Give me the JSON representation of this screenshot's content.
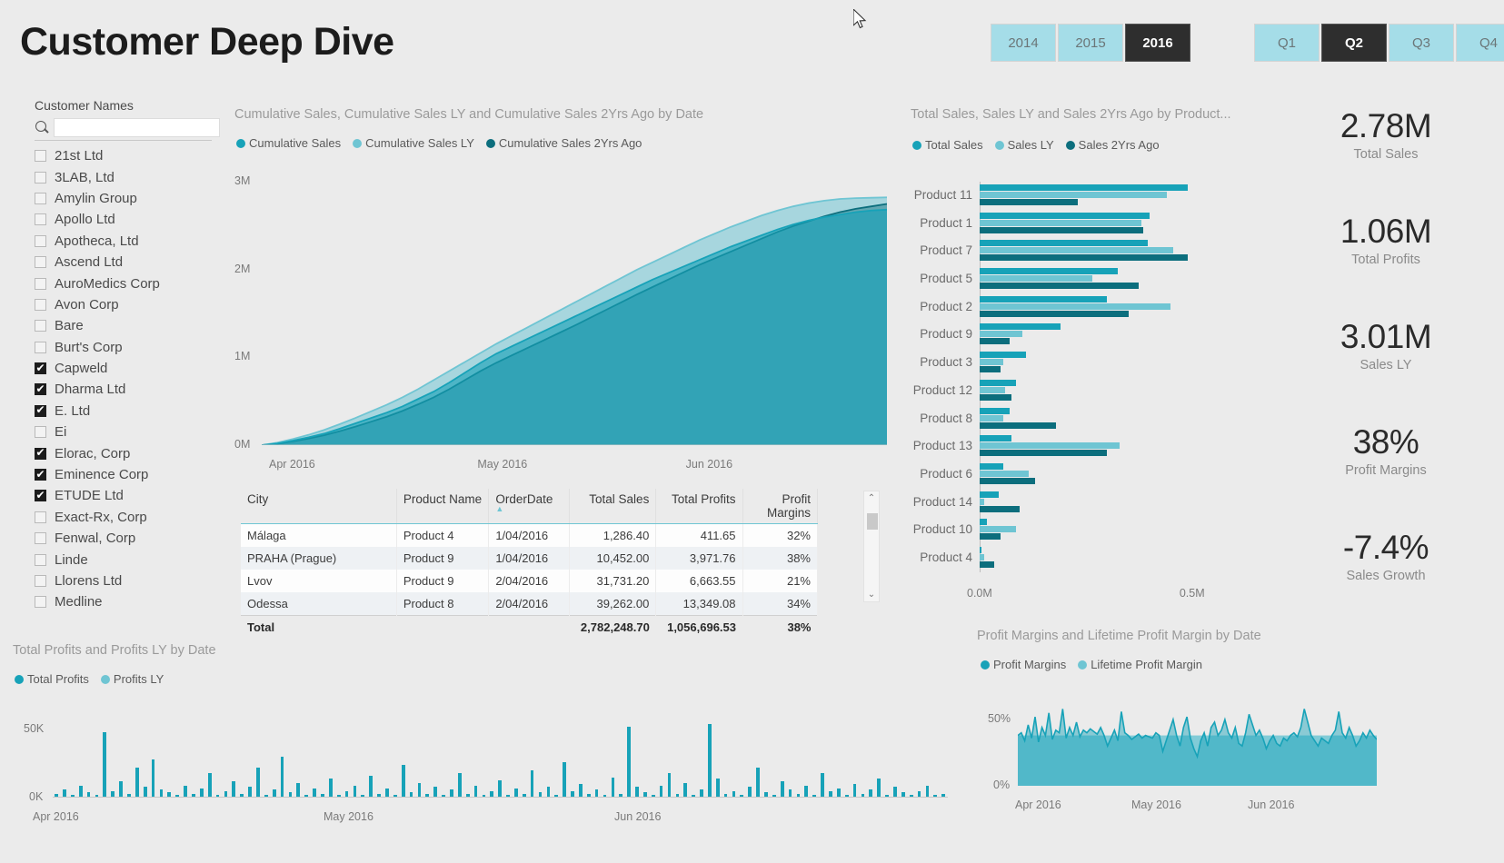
{
  "header": {
    "title": "Customer Deep Dive"
  },
  "colors": {
    "bg": "#ebebeb",
    "accent_total": "#17a2b8",
    "accent_ly": "#6fc5d3",
    "accent_2yrs": "#0c6e7d",
    "slicer_bg": "#a5dde8",
    "slicer_sel": "#2e2e2e"
  },
  "year_slicer": {
    "name": "year-slicer",
    "options": [
      "2014",
      "2015",
      "2016"
    ],
    "selected": "2016"
  },
  "quarter_slicer": {
    "name": "quarter-slicer",
    "options": [
      "Q1",
      "Q2",
      "Q3",
      "Q4"
    ],
    "selected": "Q2"
  },
  "customer_slicer": {
    "heading": "Customer Names",
    "search_value": "",
    "search_placeholder": "",
    "items": [
      {
        "label": "21st Ltd",
        "checked": false
      },
      {
        "label": "3LAB, Ltd",
        "checked": false
      },
      {
        "label": "Amylin Group",
        "checked": false
      },
      {
        "label": "Apollo Ltd",
        "checked": false
      },
      {
        "label": "Apotheca, Ltd",
        "checked": false
      },
      {
        "label": "Ascend Ltd",
        "checked": false
      },
      {
        "label": "AuroMedics Corp",
        "checked": false
      },
      {
        "label": "Avon Corp",
        "checked": false
      },
      {
        "label": "Bare",
        "checked": false
      },
      {
        "label": "Burt's Corp",
        "checked": false
      },
      {
        "label": "Capweld",
        "checked": true
      },
      {
        "label": "Dharma Ltd",
        "checked": true
      },
      {
        "label": "E. Ltd",
        "checked": true
      },
      {
        "label": "Ei",
        "checked": false
      },
      {
        "label": "Elorac, Corp",
        "checked": true
      },
      {
        "label": "Eminence Corp",
        "checked": true
      },
      {
        "label": "ETUDE Ltd",
        "checked": true
      },
      {
        "label": "Exact-Rx, Corp",
        "checked": false
      },
      {
        "label": "Fenwal, Corp",
        "checked": false
      },
      {
        "label": "Linde",
        "checked": false
      },
      {
        "label": "Llorens Ltd",
        "checked": false
      },
      {
        "label": "Medline",
        "checked": false
      }
    ]
  },
  "kpis": [
    {
      "value": "2.78M",
      "label": "Total Sales"
    },
    {
      "value": "1.06M",
      "label": "Total Profits"
    },
    {
      "value": "3.01M",
      "label": "Sales LY"
    },
    {
      "value": "38%",
      "label": "Profit Margins"
    },
    {
      "value": "-7.4%",
      "label": "Sales Growth"
    }
  ],
  "table": {
    "columns": [
      "City",
      "Product Name",
      "OrderDate",
      "Total Sales",
      "Total Profits",
      "Profit Margins"
    ],
    "sorted_column": "OrderDate",
    "sort_direction": "asc",
    "rows": [
      {
        "city": "Málaga",
        "product": "Product 4",
        "date": "1/04/2016",
        "sales": "1,286.40",
        "profits": "411.65",
        "margin": "32%"
      },
      {
        "city": "PRAHA (Prague)",
        "product": "Product 9",
        "date": "1/04/2016",
        "sales": "10,452.00",
        "profits": "3,971.76",
        "margin": "38%"
      },
      {
        "city": "Lvov",
        "product": "Product 9",
        "date": "2/04/2016",
        "sales": "31,731.20",
        "profits": "6,663.55",
        "margin": "21%"
      },
      {
        "city": "Odessa",
        "product": "Product 8",
        "date": "2/04/2016",
        "sales": "39,262.00",
        "profits": "13,349.08",
        "margin": "34%"
      }
    ],
    "total": {
      "label": "Total",
      "sales": "2,782,248.70",
      "profits": "1,056,696.53",
      "margin": "38%"
    }
  },
  "chart_data": [
    {
      "id": "cumulative_sales",
      "type": "area",
      "title": "Cumulative Sales, Cumulative Sales LY and Cumulative Sales 2Yrs Ago by Date",
      "legend": [
        "Cumulative Sales",
        "Cumulative Sales LY",
        "Cumulative Sales 2Yrs Ago"
      ],
      "legend_position": "top",
      "xlabel": "",
      "ylabel": "",
      "x_ticks": [
        "Apr 2016",
        "May 2016",
        "Jun 2016"
      ],
      "y_ticks": [
        "0M",
        "1M",
        "2M",
        "3M"
      ],
      "ylim": [
        0,
        3200000
      ],
      "grid": false,
      "x": [
        0,
        1,
        2,
        3,
        4,
        5,
        6,
        7,
        8,
        9,
        10,
        11,
        12,
        13,
        14,
        15,
        16,
        17,
        18,
        19,
        20,
        21,
        22,
        23,
        24,
        25,
        26,
        27,
        28,
        29,
        30,
        31,
        32,
        33,
        34,
        35,
        36,
        37,
        38,
        39,
        40
      ],
      "series": [
        {
          "name": "Cumulative Sales",
          "values": [
            0,
            20000,
            55000,
            95000,
            140000,
            200000,
            265000,
            330000,
            395000,
            470000,
            560000,
            650000,
            760000,
            880000,
            1000000,
            1110000,
            1200000,
            1290000,
            1380000,
            1470000,
            1560000,
            1650000,
            1740000,
            1830000,
            1920000,
            2010000,
            2090000,
            2170000,
            2250000,
            2330000,
            2410000,
            2480000,
            2550000,
            2620000,
            2680000,
            2730000,
            2770000,
            2800000,
            2830000,
            2850000,
            2860000
          ]
        },
        {
          "name": "Cumulative Sales LY",
          "values": [
            0,
            30000,
            75000,
            125000,
            185000,
            255000,
            330000,
            410000,
            490000,
            580000,
            680000,
            790000,
            900000,
            1010000,
            1120000,
            1230000,
            1330000,
            1430000,
            1530000,
            1630000,
            1730000,
            1830000,
            1930000,
            2030000,
            2130000,
            2220000,
            2310000,
            2400000,
            2490000,
            2570000,
            2650000,
            2720000,
            2790000,
            2850000,
            2900000,
            2940000,
            2970000,
            2990000,
            3000000,
            3005000,
            3010000
          ]
        },
        {
          "name": "Cumulative Sales 2Yrs Ago",
          "values": [
            0,
            15000,
            45000,
            80000,
            120000,
            170000,
            225000,
            285000,
            345000,
            415000,
            495000,
            580000,
            680000,
            790000,
            900000,
            1000000,
            1090000,
            1180000,
            1270000,
            1360000,
            1450000,
            1545000,
            1640000,
            1735000,
            1830000,
            1920000,
            2010000,
            2100000,
            2190000,
            2270000,
            2350000,
            2430000,
            2510000,
            2590000,
            2660000,
            2720000,
            2780000,
            2830000,
            2870000,
            2900000,
            2930000
          ]
        }
      ]
    },
    {
      "id": "sales_by_product",
      "type": "bar",
      "orientation": "horizontal",
      "title": "Total Sales, Sales LY and Sales 2Yrs Ago by Product...",
      "legend": [
        "Total Sales",
        "Sales LY",
        "Sales 2Yrs Ago"
      ],
      "legend_position": "top",
      "categories": [
        "Product 11",
        "Product 1",
        "Product 7",
        "Product 5",
        "Product 2",
        "Product 9",
        "Product 3",
        "Product 12",
        "Product 8",
        "Product 13",
        "Product 6",
        "Product 14",
        "Product 10",
        "Product 4"
      ],
      "x_ticks": [
        "0.0M",
        "0.5M"
      ],
      "xlim": [
        0,
        0.62
      ],
      "grid": false,
      "series": [
        {
          "name": "Total Sales",
          "values": [
            0.49,
            0.4,
            0.395,
            0.325,
            0.3,
            0.19,
            0.11,
            0.085,
            0.07,
            0.075,
            0.055,
            0.045,
            0.018,
            0.005
          ]
        },
        {
          "name": "Sales LY",
          "values": [
            0.44,
            0.38,
            0.455,
            0.265,
            0.45,
            0.1,
            0.055,
            0.06,
            0.055,
            0.33,
            0.115,
            0.01,
            0.085,
            0.01
          ]
        },
        {
          "name": "Sales 2Yrs Ago",
          "values": [
            0.23,
            0.385,
            0.49,
            0.375,
            0.35,
            0.07,
            0.05,
            0.075,
            0.18,
            0.3,
            0.13,
            0.095,
            0.05,
            0.035
          ]
        }
      ]
    },
    {
      "id": "profits_by_date",
      "type": "bar",
      "title": "Total Profits and Profits LY by Date",
      "legend": [
        "Total Profits",
        "Profits LY"
      ],
      "legend_position": "top",
      "y_ticks": [
        "0K",
        "50K"
      ],
      "ylim": [
        0,
        60000
      ],
      "x_ticks": [
        "Apr 2016",
        "May 2016",
        "Jun 2016"
      ],
      "grid": false,
      "values": [
        3000,
        6000,
        2000,
        9000,
        4000,
        2000,
        48000,
        5000,
        12000,
        3000,
        22000,
        8000,
        28000,
        6000,
        4000,
        2000,
        9000,
        3000,
        7000,
        18000,
        2000,
        5000,
        12000,
        3000,
        8000,
        22000,
        2000,
        6000,
        30000,
        4000,
        11000,
        2000,
        7000,
        3000,
        14000,
        2000,
        5000,
        9000,
        2000,
        16000,
        3000,
        7000,
        2000,
        24000,
        4000,
        11000,
        3000,
        8000,
        2000,
        6000,
        18000,
        3000,
        9000,
        2000,
        5000,
        13000,
        2000,
        7000,
        3000,
        20000,
        4000,
        8000,
        2000,
        26000,
        5000,
        10000,
        3000,
        6000,
        2000,
        15000,
        3000,
        52000,
        8000,
        4000,
        2000,
        9000,
        18000,
        3000,
        11000,
        2000,
        6000,
        54000,
        14000,
        3000,
        5000,
        2000,
        8000,
        22000,
        4000,
        2000,
        12000,
        6000,
        3000,
        9000,
        2000,
        18000,
        5000,
        7000,
        2000,
        10000,
        3000,
        6000,
        14000,
        2000,
        8000,
        4000,
        2000,
        5000,
        9000,
        2000,
        3000
      ]
    },
    {
      "id": "profit_margins_by_date",
      "type": "line",
      "title": "Profit Margins and Lifetime Profit Margin by Date",
      "legend": [
        "Profit Margins",
        "Lifetime Profit Margin"
      ],
      "legend_position": "top",
      "y_ticks": [
        "0%",
        "50%"
      ],
      "ylim": [
        0,
        0.72
      ],
      "x_ticks": [
        "Apr 2016",
        "May 2016",
        "Jun 2016"
      ],
      "grid": false,
      "lifetime_value": 0.38,
      "values": [
        0.38,
        0.4,
        0.34,
        0.46,
        0.36,
        0.52,
        0.33,
        0.44,
        0.38,
        0.55,
        0.35,
        0.42,
        0.4,
        0.58,
        0.36,
        0.44,
        0.38,
        0.48,
        0.37,
        0.42,
        0.4,
        0.43,
        0.41,
        0.39,
        0.44,
        0.38,
        0.3,
        0.36,
        0.42,
        0.34,
        0.56,
        0.4,
        0.38,
        0.35,
        0.37,
        0.39,
        0.36,
        0.38,
        0.37,
        0.36,
        0.4,
        0.38,
        0.26,
        0.34,
        0.42,
        0.5,
        0.38,
        0.3,
        0.44,
        0.52,
        0.36,
        0.28,
        0.22,
        0.34,
        0.4,
        0.3,
        0.44,
        0.48,
        0.38,
        0.42,
        0.5,
        0.4,
        0.36,
        0.44,
        0.32,
        0.3,
        0.4,
        0.54,
        0.46,
        0.38,
        0.42,
        0.36,
        0.28,
        0.34,
        0.38,
        0.32,
        0.3,
        0.36,
        0.34,
        0.38,
        0.4,
        0.37,
        0.44,
        0.58,
        0.48,
        0.38,
        0.34,
        0.3,
        0.36,
        0.34,
        0.32,
        0.38,
        0.42,
        0.56,
        0.4,
        0.36,
        0.44,
        0.38,
        0.3,
        0.34,
        0.4,
        0.36,
        0.42,
        0.38,
        0.35
      ]
    }
  ]
}
